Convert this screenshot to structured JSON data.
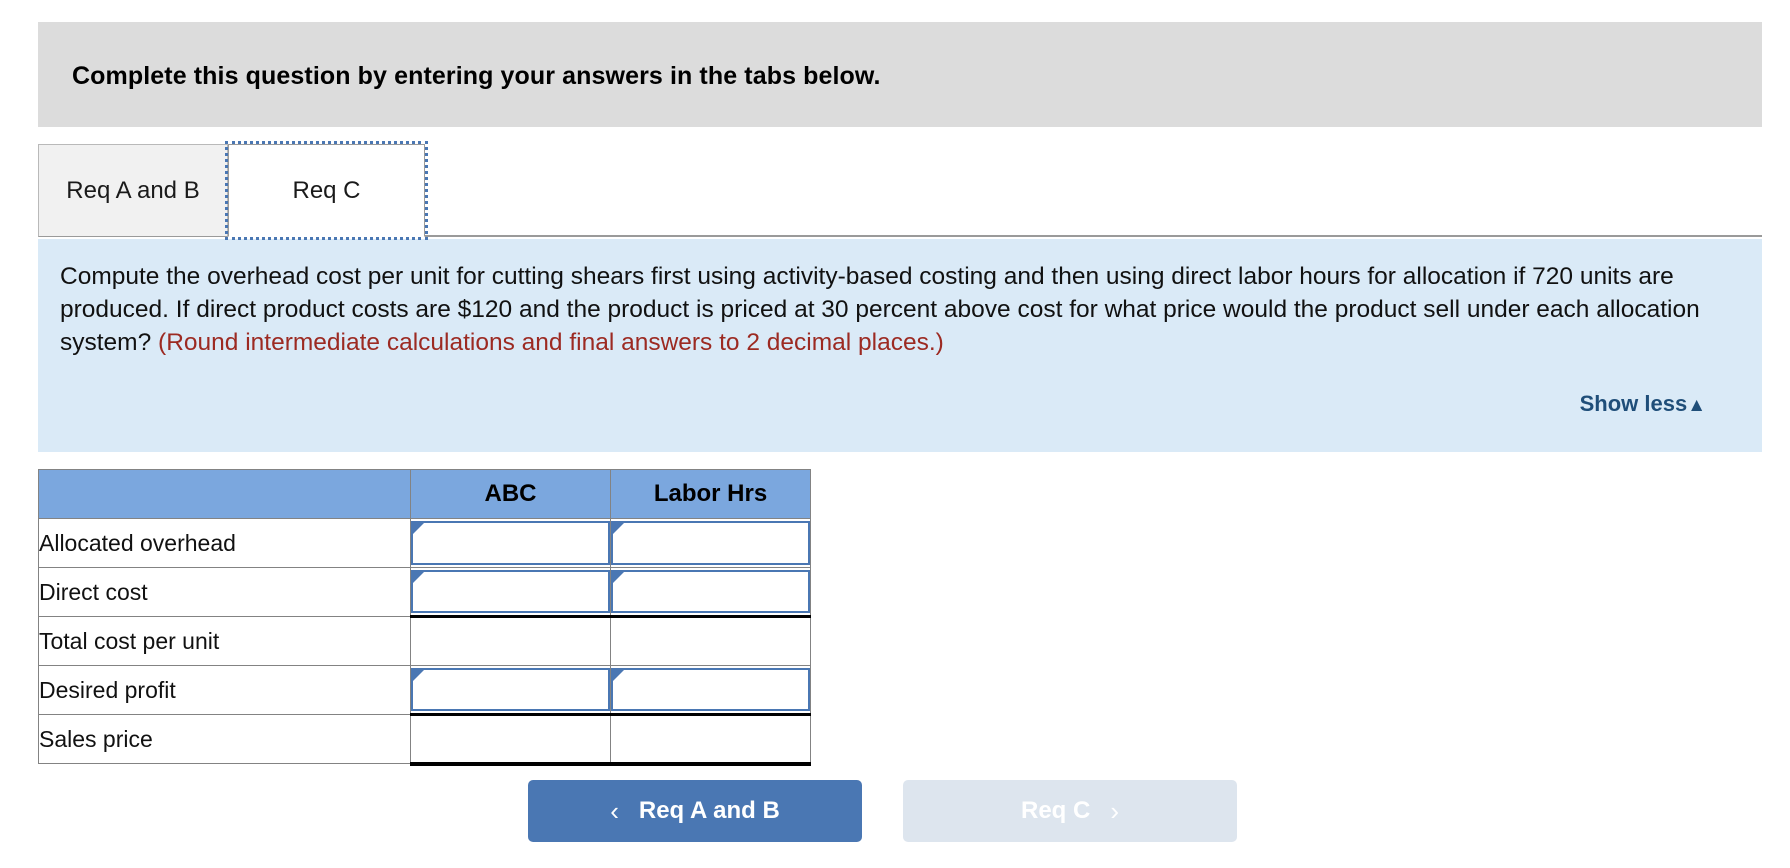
{
  "banner": {
    "title": "Complete this question by entering your answers in the tabs below."
  },
  "tabs": [
    {
      "label": "Req A and B",
      "active": false
    },
    {
      "label": "Req C",
      "active": true
    }
  ],
  "question": {
    "body_part1": "Compute the overhead cost per unit for cutting shears first using activity-based costing and then using direct labor hours for allocation if 720 units are produced. If direct product costs are $120 and the product is priced at 30 percent above cost for what price would the product sell under each allocation system? ",
    "hint": "(Round intermediate calculations and final answers to 2 decimal places.)",
    "show_less_label": "Show less",
    "show_less_caret": "▲"
  },
  "worksheet": {
    "columns": [
      "",
      "ABC",
      "Labor Hrs"
    ],
    "rows": [
      {
        "label": "Allocated overhead",
        "abc": "",
        "labor": "",
        "editable": true,
        "style": "input"
      },
      {
        "label": "Direct cost",
        "abc": "",
        "labor": "",
        "editable": true,
        "style": "input"
      },
      {
        "label": "Total cost per unit",
        "abc": "",
        "labor": "",
        "editable": false,
        "style": "subtotal"
      },
      {
        "label": "Desired profit",
        "abc": "",
        "labor": "",
        "editable": true,
        "style": "input"
      },
      {
        "label": "Sales price",
        "abc": "",
        "labor": "",
        "editable": false,
        "style": "total"
      }
    ]
  },
  "nav": {
    "prev_label": "Req A and B",
    "prev_chevron": "‹",
    "next_label": "Req C",
    "next_chevron": "›"
  },
  "colors": {
    "banner_bg": "#dcdcdc",
    "question_bg": "#daeaf7",
    "hint_red": "#9c2a22",
    "header_blue": "#7ba7de",
    "accent_blue": "#4a77b3",
    "link_blue": "#1f4e79",
    "disabled_btn": "#dde5ee"
  }
}
